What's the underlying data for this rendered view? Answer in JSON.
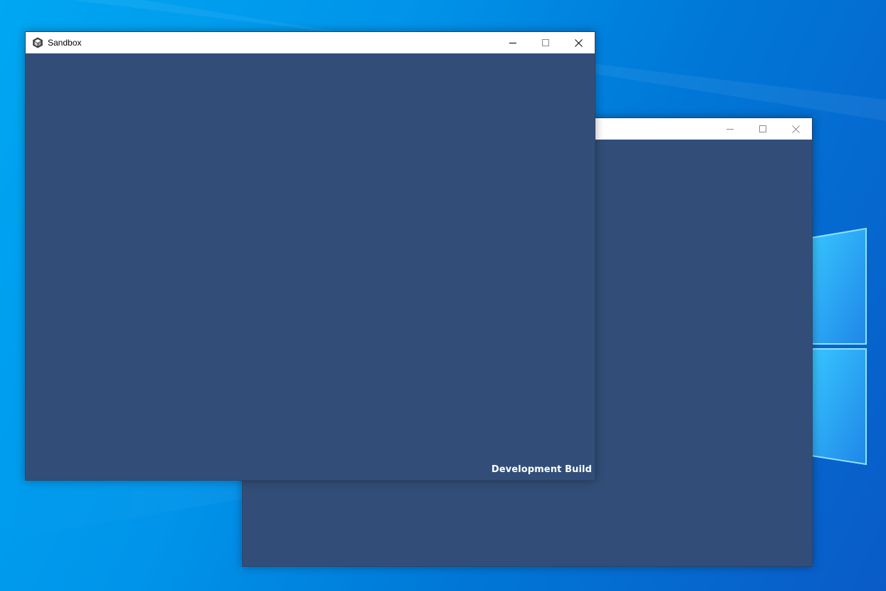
{
  "front_window": {
    "title": "Sandbox",
    "app_icon": "unity-cube-icon",
    "content_background": "#324e78",
    "watermark": "Development Build",
    "controls": [
      "minimize-icon",
      "maximize-icon",
      "close-icon"
    ]
  },
  "back_window": {
    "title": "",
    "content_background": "#324e78",
    "controls": [
      "minimize-icon",
      "maximize-icon",
      "close-icon"
    ]
  },
  "desktop": {
    "wallpaper": "windows-logo-wallpaper",
    "colors": {
      "primary": "#0094ea",
      "light": "#00b4f5",
      "dark": "#0a5bc8"
    }
  }
}
